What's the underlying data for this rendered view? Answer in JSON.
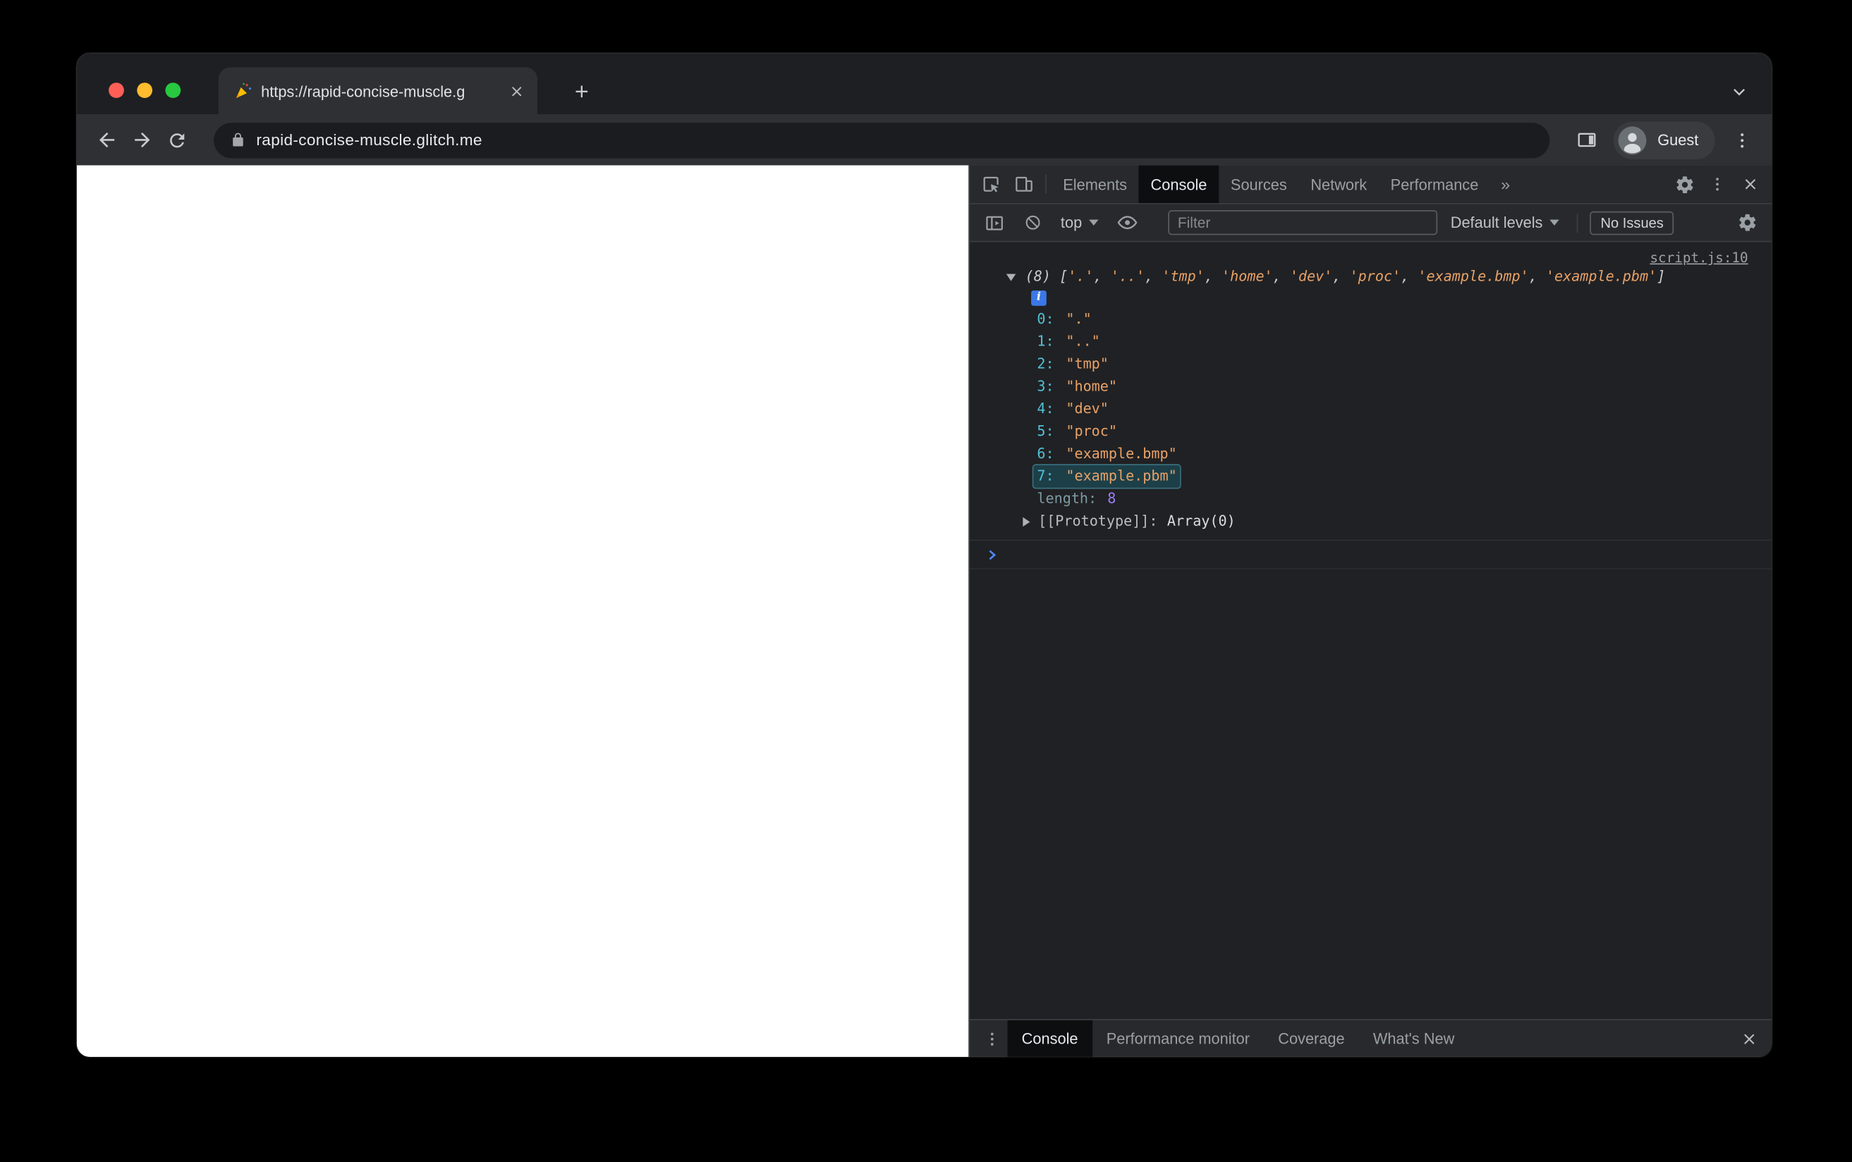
{
  "colors": {
    "accent_string": "#e8a268",
    "accent_index": "#52c0d6",
    "accent_number": "#9d7ef7",
    "accent_prompt": "#4f87f5",
    "accent_link": "#9aa0a6",
    "info_badge_bg": "#3b78e7",
    "traffic_red": "#ff5f57",
    "traffic_yellow": "#febc2e",
    "traffic_green": "#28c840"
  },
  "window": {
    "tab": {
      "title": "https://rapid-concise-muscle.g"
    },
    "url": "rapid-concise-muscle.glitch.me",
    "profile": {
      "label": "Guest"
    }
  },
  "devtools": {
    "main_tabs": [
      {
        "label": "Elements"
      },
      {
        "label": "Console",
        "class": "active"
      },
      {
        "label": "Sources"
      },
      {
        "label": "Network"
      },
      {
        "label": "Performance"
      }
    ],
    "more_tabs_symbol": "»",
    "console_toolbar": {
      "context_selector": "top",
      "filter_placeholder": "Filter",
      "levels_label": "Default levels",
      "issues_label": "No Issues"
    },
    "console": {
      "source_link": "script.js:10",
      "info_badge": "i",
      "preview_segments": [
        {
          "text": "(8) ",
          "class": "seg-plain"
        },
        {
          "text": "[",
          "class": "seg-plain"
        },
        {
          "text": "'.'",
          "class": "seg-string"
        },
        {
          "text": ", ",
          "class": "seg-plain"
        },
        {
          "text": "'..'",
          "class": "seg-string"
        },
        {
          "text": ", ",
          "class": "seg-plain"
        },
        {
          "text": "'tmp'",
          "class": "seg-string"
        },
        {
          "text": ", ",
          "class": "seg-plain"
        },
        {
          "text": "'home'",
          "class": "seg-string"
        },
        {
          "text": ", ",
          "class": "seg-plain"
        },
        {
          "text": "'dev'",
          "class": "seg-string"
        },
        {
          "text": ", ",
          "class": "seg-plain"
        },
        {
          "text": "'proc'",
          "class": "seg-string"
        },
        {
          "text": ", ",
          "class": "seg-plain"
        },
        {
          "text": "'example.bmp'",
          "class": "seg-string"
        },
        {
          "text": ", ",
          "class": "seg-plain"
        },
        {
          "text": "'example.pbm'",
          "class": "seg-string"
        },
        {
          "text": "]",
          "class": "seg-plain"
        }
      ],
      "entries": [
        {
          "index": "0:",
          "value": "\".\""
        },
        {
          "index": "1:",
          "value": "\"..\""
        },
        {
          "index": "2:",
          "value": "\"tmp\""
        },
        {
          "index": "3:",
          "value": "\"home\""
        },
        {
          "index": "4:",
          "value": "\"dev\""
        },
        {
          "index": "5:",
          "value": "\"proc\""
        },
        {
          "index": "6:",
          "value": "\"example.bmp\""
        },
        {
          "index": "7:",
          "value": "\"example.pbm\"",
          "class": "highlighted"
        }
      ],
      "length_label": "length:",
      "length_value": "8",
      "prototype_label": "[[Prototype]]:",
      "prototype_value": "Array(0)"
    },
    "drawer_tabs": [
      {
        "label": "Console",
        "class": "active"
      },
      {
        "label": "Performance monitor"
      },
      {
        "label": "Coverage"
      },
      {
        "label": "What's New"
      }
    ]
  }
}
